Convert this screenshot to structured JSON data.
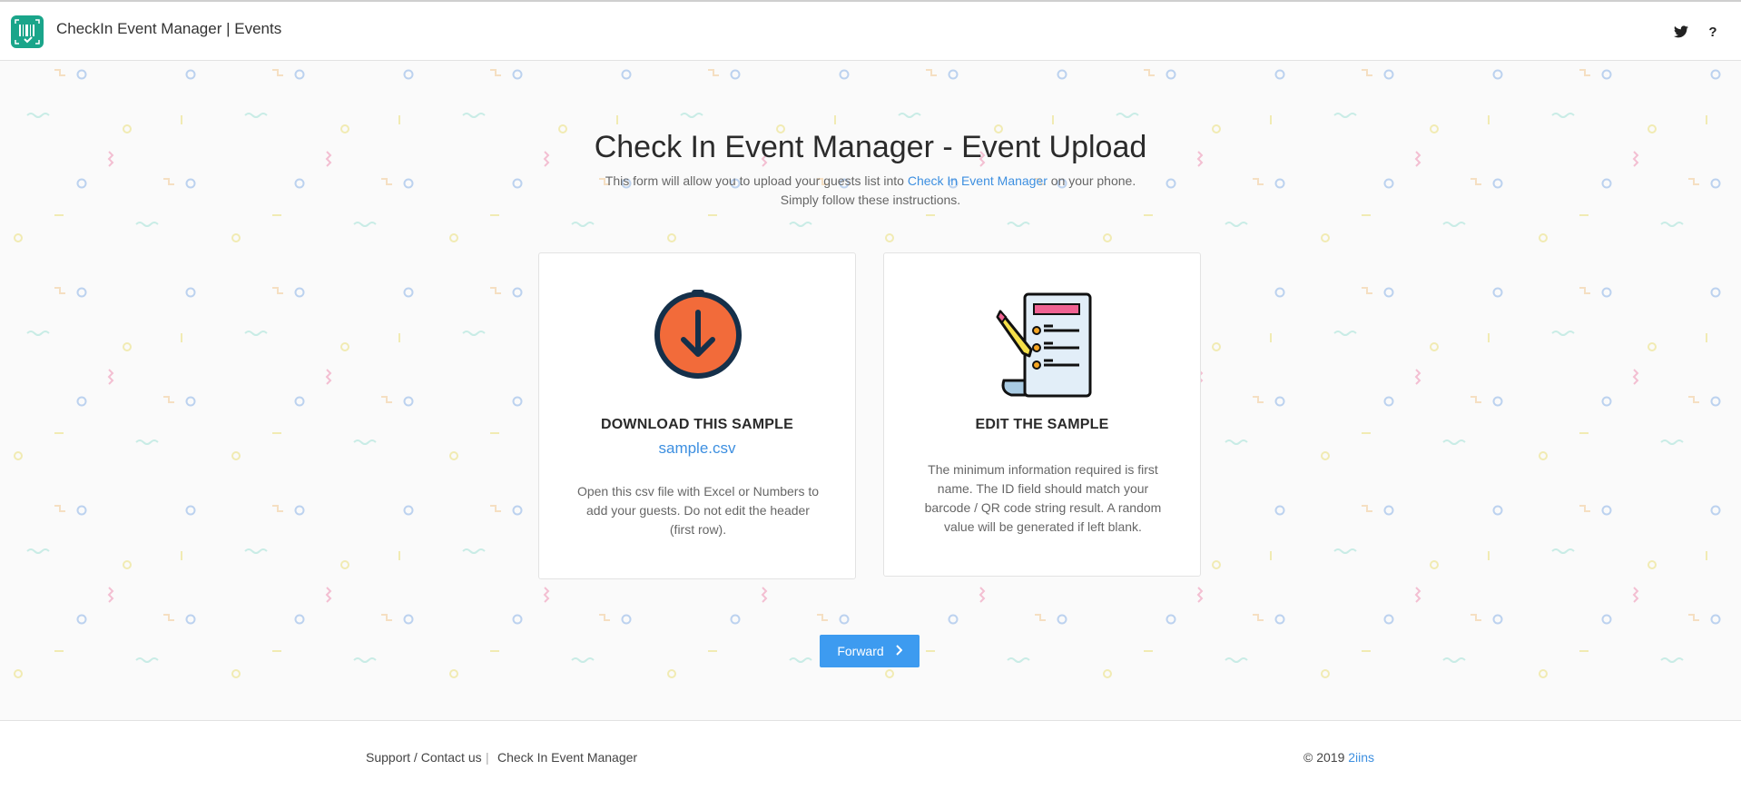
{
  "header": {
    "app_title": "CheckIn Event Manager | Events",
    "twitter_icon": "twitter-icon",
    "help_label": "?"
  },
  "main": {
    "title": "Check In Event Manager - Event Upload",
    "subtitle_pre": "This form will allow you to upload your guests list into ",
    "subtitle_link": "Check In Event Manager",
    "subtitle_post": " on your phone.",
    "subtitle_line2": "Simply follow these instructions."
  },
  "cards": [
    {
      "icon": "download-icon",
      "title": "DOWNLOAD THIS SAMPLE",
      "link": "sample.csv",
      "description": "Open this csv file with Excel or Numbers to add your guests. Do not edit the header (first row)."
    },
    {
      "icon": "document-pencil-icon",
      "title": "EDIT THE SAMPLE",
      "description": "The minimum information required is first name. The ID field should match your barcode / QR code string result. A random value will be generated if left blank."
    }
  ],
  "forward_button": {
    "label": "Forward"
  },
  "footer": {
    "support": "Support / Contact us",
    "separator": "|",
    "app_link": "Check In Event Manager",
    "copyright": "© 2019 ",
    "company": "2iins"
  },
  "colors": {
    "accent": "#3d9bf0",
    "link": "#3d8fe0",
    "logo": "#1aa58a",
    "download_circle": "#f26b3a"
  }
}
